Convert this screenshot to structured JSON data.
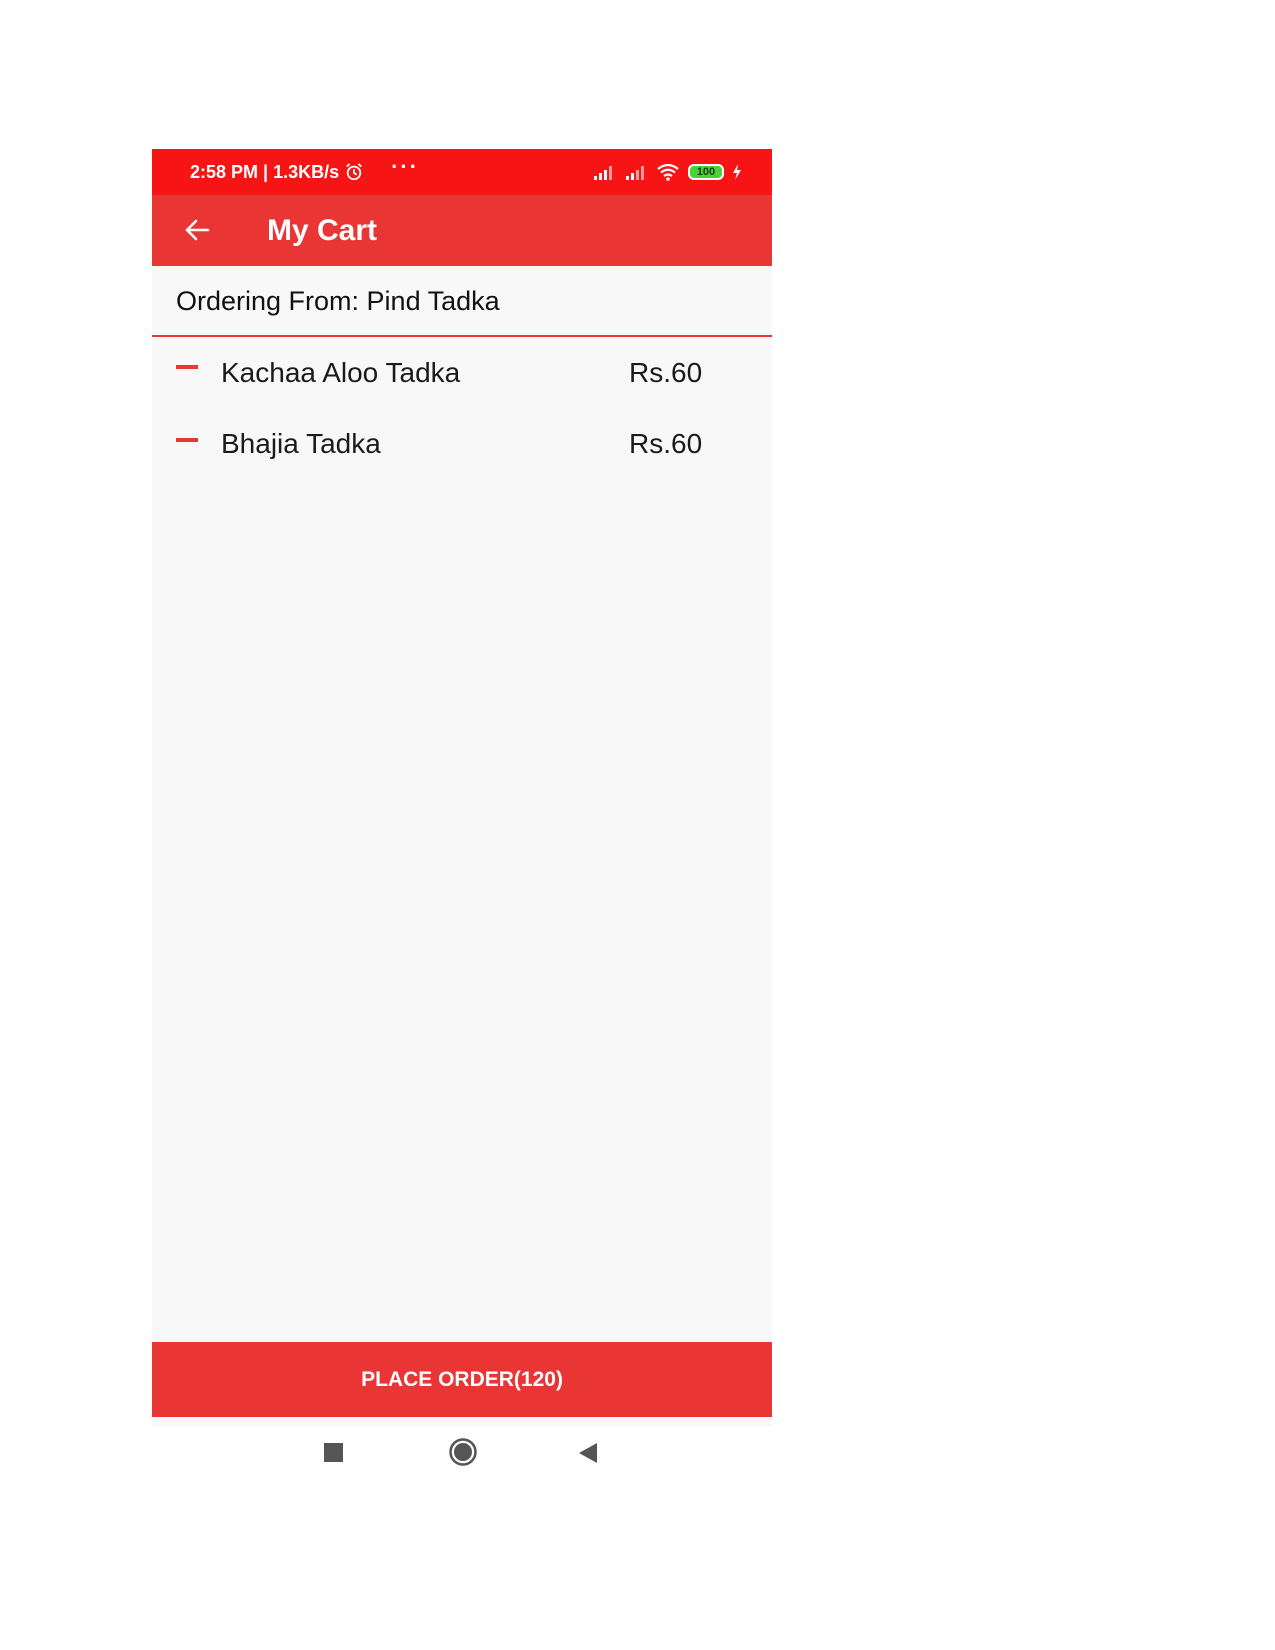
{
  "status_bar": {
    "time_speed": "2:58 PM | 1.3KB/s",
    "more_dots": "···",
    "battery_level": "100",
    "icons": [
      "alarm-icon",
      "signal-icon",
      "signal-icon",
      "wifi-icon",
      "battery-icon",
      "charging-icon"
    ]
  },
  "app_bar": {
    "title": "My Cart",
    "back_icon": "arrow-left-icon"
  },
  "ordering": {
    "text": "Ordering From: Pind Tadka"
  },
  "cart": {
    "items": [
      {
        "name": "Kachaa Aloo Tadka",
        "price": "Rs.60"
      },
      {
        "name": "Bhajia Tadka",
        "price": "Rs.60"
      }
    ]
  },
  "place_order": {
    "label": "PLACE ORDER(120)"
  },
  "colors": {
    "status_bar": "#f71414",
    "app_bar": "#ea3535",
    "accent": "#e53935",
    "background": "#f8f8f8"
  }
}
